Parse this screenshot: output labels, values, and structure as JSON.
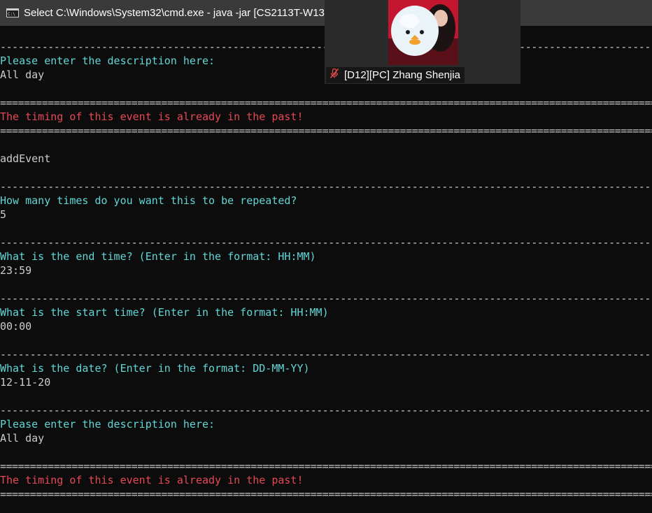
{
  "window": {
    "title": "Select C:\\Windows\\System32\\cmd.exe - java  -jar [CS2113T-W13-"
  },
  "video_call": {
    "participant_name": "[D12][PC] Zhang Shenjia",
    "mic_status": "muted"
  },
  "console": {
    "separator_dash": "------------------------------------------------------------------------------------------------------------------------------------------------",
    "separator_equals": "================================================================================================================================================",
    "lines": [
      {
        "type": "dash",
        "text": ""
      },
      {
        "type": "prompt",
        "text": "Please enter the description here:"
      },
      {
        "type": "input",
        "text": "All day"
      },
      {
        "type": "blank",
        "text": ""
      },
      {
        "type": "equals",
        "text": ""
      },
      {
        "type": "error",
        "text": "The timing of this event is already in the past!"
      },
      {
        "type": "equals",
        "text": ""
      },
      {
        "type": "blank",
        "text": ""
      },
      {
        "type": "input",
        "text": "addEvent"
      },
      {
        "type": "blank",
        "text": ""
      },
      {
        "type": "dash",
        "text": ""
      },
      {
        "type": "prompt",
        "text": "How many times do you want this to be repeated?"
      },
      {
        "type": "input",
        "text": "5"
      },
      {
        "type": "blank",
        "text": ""
      },
      {
        "type": "dash",
        "text": ""
      },
      {
        "type": "prompt",
        "text": "What is the end time? (Enter in the format: HH:MM)"
      },
      {
        "type": "input",
        "text": "23:59"
      },
      {
        "type": "blank",
        "text": ""
      },
      {
        "type": "dash",
        "text": ""
      },
      {
        "type": "prompt",
        "text": "What is the start time? (Enter in the format: HH:MM)"
      },
      {
        "type": "input",
        "text": "00:00"
      },
      {
        "type": "blank",
        "text": ""
      },
      {
        "type": "dash",
        "text": ""
      },
      {
        "type": "prompt",
        "text": "What is the date? (Enter in the format: DD-MM-YY)"
      },
      {
        "type": "input",
        "text": "12-11-20"
      },
      {
        "type": "blank",
        "text": ""
      },
      {
        "type": "dash",
        "text": ""
      },
      {
        "type": "prompt",
        "text": "Please enter the description here:"
      },
      {
        "type": "input",
        "text": "All day"
      },
      {
        "type": "blank",
        "text": ""
      },
      {
        "type": "equals",
        "text": ""
      },
      {
        "type": "error",
        "text": "The timing of this event is already in the past!"
      },
      {
        "type": "equals",
        "text": ""
      }
    ]
  },
  "colors": {
    "background": "#0c0c0c",
    "prompt": "#61d6d6",
    "error": "#e74856",
    "text": "#cccccc",
    "titlebar": "#3a3a3a"
  }
}
